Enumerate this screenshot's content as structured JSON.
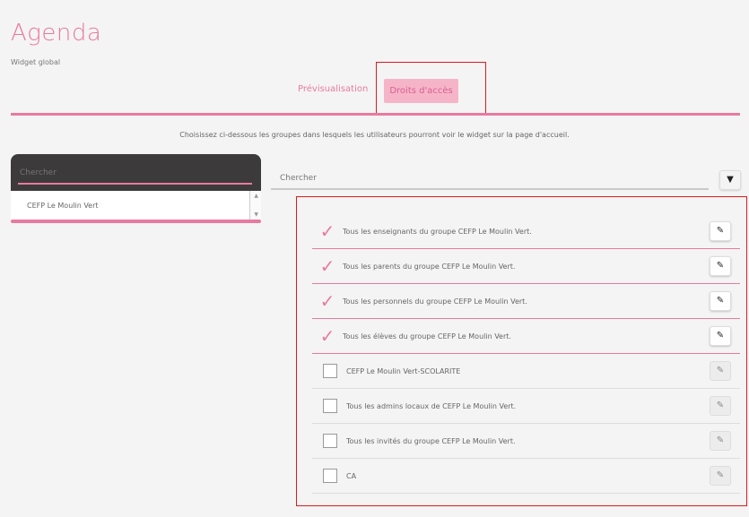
{
  "header": {
    "title": "Agenda",
    "subtitle": "Widget global"
  },
  "tabs": [
    {
      "label": "Prévisualisation",
      "active": false
    },
    {
      "label": "Droits d'accès",
      "active": true
    }
  ],
  "instructions": "Choisissez ci-dessous les groupes dans lesquels les utilisateurs pourront voir le widget sur la page d'accueil.",
  "left": {
    "search_placeholder": "Chercher",
    "items": [
      {
        "label": "CEFP Le Moulin Vert"
      }
    ]
  },
  "right": {
    "search_placeholder": "Chercher",
    "filter_icon": "filter-icon",
    "groups": [
      {
        "label": "Tous les enseignants du groupe CEFP Le Moulin Vert.",
        "checked": true
      },
      {
        "label": "Tous les parents du groupe CEFP Le Moulin Vert.",
        "checked": true
      },
      {
        "label": "Tous les personnels du groupe CEFP Le Moulin Vert.",
        "checked": true
      },
      {
        "label": "Tous les élèves du groupe CEFP Le Moulin Vert.",
        "checked": true
      },
      {
        "label": "CEFP Le Moulin Vert-SCOLARITE",
        "checked": false
      },
      {
        "label": "Tous les admins locaux de CEFP Le Moulin Vert.",
        "checked": false
      },
      {
        "label": "Tous les invités du groupe CEFP Le Moulin Vert.",
        "checked": false
      },
      {
        "label": "CA",
        "checked": false
      }
    ]
  },
  "colors": {
    "accent": "#e87aa0",
    "highlight": "#e01a1a"
  }
}
